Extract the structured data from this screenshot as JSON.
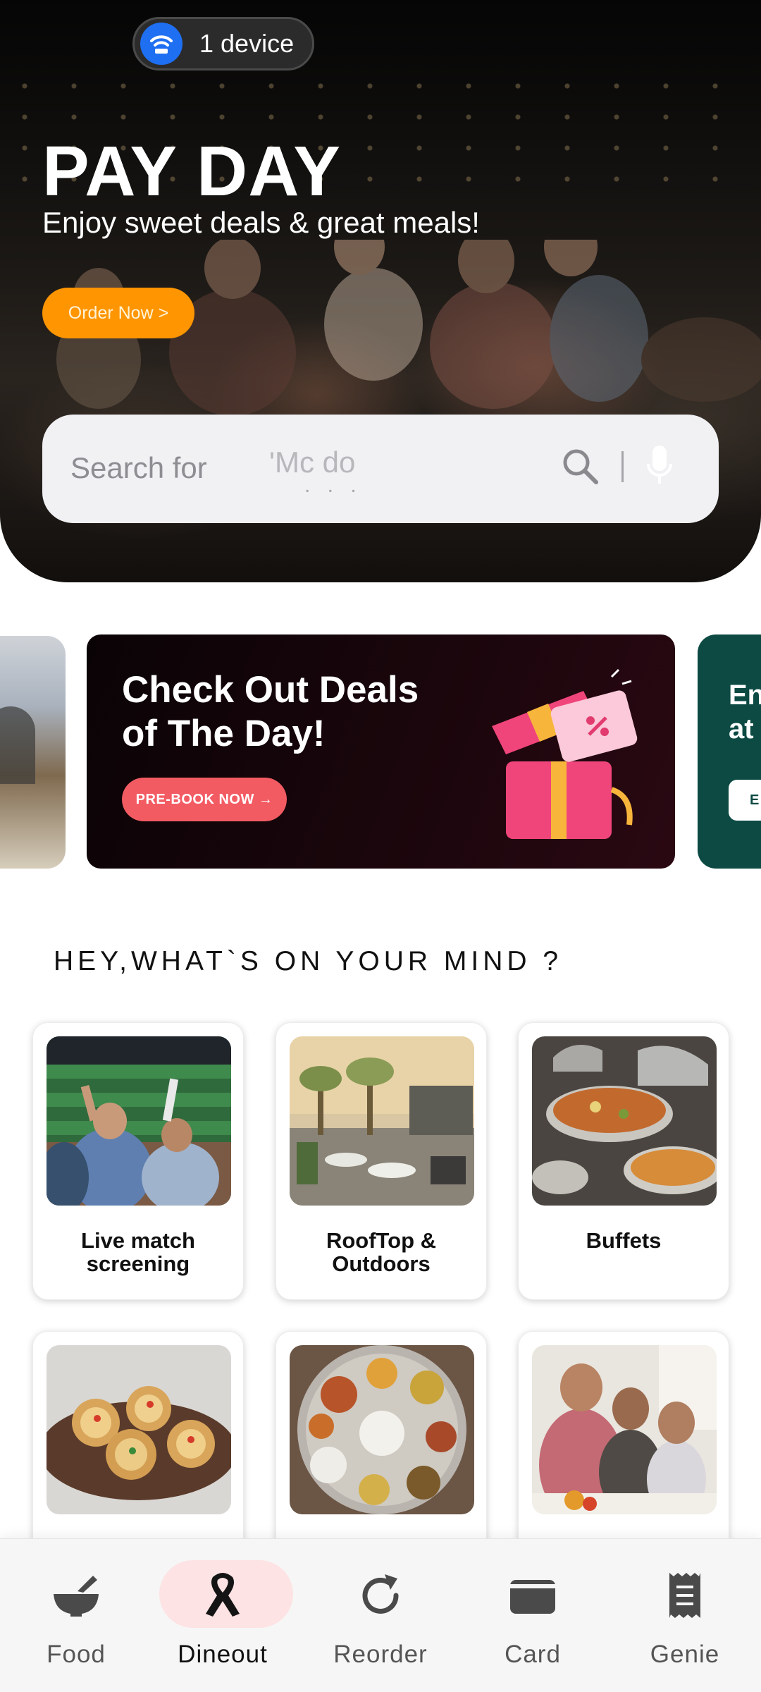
{
  "status_chip": {
    "label": "1 device",
    "icon": "wifi-hotspot-icon"
  },
  "hero": {
    "title": "PAY DAY",
    "subtitle": "Enjoy sweet deals & great meals!",
    "cta": "Order Now >"
  },
  "search": {
    "placeholder": "Search for",
    "rotating_hint": "'Mc do",
    "dots": ". . .",
    "icons": [
      "search-icon",
      "microphone-icon"
    ]
  },
  "banners": {
    "main": {
      "title_line1": "Check Out Deals",
      "title_line2": "of The Day!",
      "button": "PRE-BOOK NOW →"
    },
    "right": {
      "title_line1": "En",
      "title_line2": "at",
      "button": "E"
    }
  },
  "section": {
    "title": "HEY,WHAT`S ON YOUR MIND ?"
  },
  "categories": [
    {
      "line1": "Live match",
      "line2": "screening"
    },
    {
      "line1": "RoofTop &",
      "line2": "Outdoors"
    },
    {
      "line1": "Buffets",
      "line2": ""
    },
    {
      "line1": "",
      "line2": ""
    },
    {
      "line1": "",
      "line2": ""
    },
    {
      "line1": "",
      "line2": ""
    }
  ],
  "bottom_nav": {
    "active": "Dineout",
    "items": [
      {
        "label": "Food",
        "icon": "mortar-bowl-icon"
      },
      {
        "label": "Dineout",
        "icon": "ribbon-icon"
      },
      {
        "label": "Reorder",
        "icon": "refresh-icon"
      },
      {
        "label": "Card",
        "icon": "wallet-icon"
      },
      {
        "label": "Genie",
        "icon": "receipt-icon"
      }
    ]
  },
  "colors": {
    "order_button": "#ff9500",
    "prebook_button": "#f35b63",
    "active_nav_pill": "#fde3e4",
    "right_banner": "#0c4a43"
  }
}
